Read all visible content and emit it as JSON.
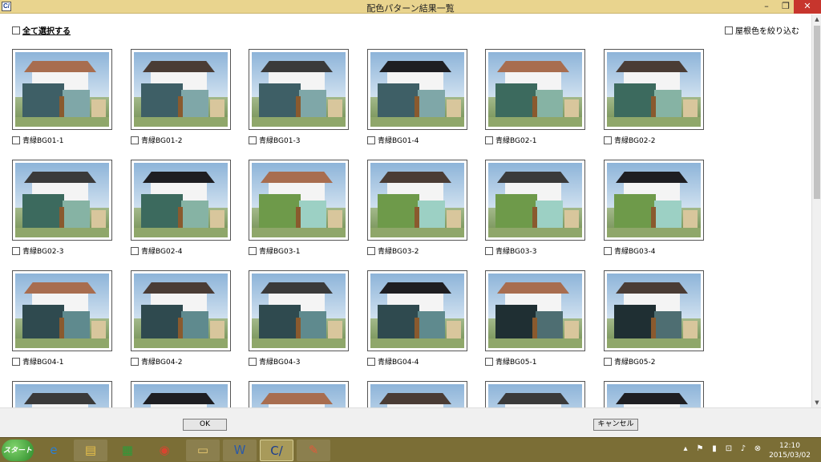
{
  "window": {
    "title": "配色パターン結果一覧",
    "app_icon_text": "C/",
    "min_glyph": "–",
    "max_glyph": "❐",
    "close_glyph": "✕"
  },
  "controls": {
    "select_all_label": "全て選択する",
    "roof_filter_label": "屋根色を絞り込む"
  },
  "items": [
    {
      "label": "青緑BG01-1",
      "roof": "#a86d4f",
      "wall": "#3e5f66",
      "wall2": "#7fa7a8"
    },
    {
      "label": "青緑BG01-2",
      "roof": "#4a3c35",
      "wall": "#3e5f66",
      "wall2": "#7fa7a8"
    },
    {
      "label": "青緑BG01-3",
      "roof": "#3a3a3a",
      "wall": "#3e5f66",
      "wall2": "#7fa7a8"
    },
    {
      "label": "青緑BG01-4",
      "roof": "#1e1e22",
      "wall": "#3e5f66",
      "wall2": "#7fa7a8"
    },
    {
      "label": "青緑BG02-1",
      "roof": "#a86d4f",
      "wall": "#3c6a5e",
      "wall2": "#86b3a4"
    },
    {
      "label": "青緑BG02-2",
      "roof": "#4a3c35",
      "wall": "#3c6a5e",
      "wall2": "#86b3a4"
    },
    {
      "label": "青緑BG02-3",
      "roof": "#3a3a3a",
      "wall": "#3c6a5e",
      "wall2": "#86b3a4"
    },
    {
      "label": "青緑BG02-4",
      "roof": "#1e1e22",
      "wall": "#3c6a5e",
      "wall2": "#86b3a4"
    },
    {
      "label": "青緑BG03-1",
      "roof": "#a86d4f",
      "wall": "#6e9a4a",
      "wall2": "#9cd0c4"
    },
    {
      "label": "青緑BG03-2",
      "roof": "#4a3c35",
      "wall": "#6e9a4a",
      "wall2": "#9cd0c4"
    },
    {
      "label": "青緑BG03-3",
      "roof": "#3a3a3a",
      "wall": "#6e9a4a",
      "wall2": "#9cd0c4"
    },
    {
      "label": "青緑BG03-4",
      "roof": "#1e1e22",
      "wall": "#6e9a4a",
      "wall2": "#9cd0c4"
    },
    {
      "label": "青緑BG04-1",
      "roof": "#a86d4f",
      "wall": "#2f4a4f",
      "wall2": "#5f8a8e"
    },
    {
      "label": "青緑BG04-2",
      "roof": "#4a3c35",
      "wall": "#2f4a4f",
      "wall2": "#5f8a8e"
    },
    {
      "label": "青緑BG04-3",
      "roof": "#3a3a3a",
      "wall": "#2f4a4f",
      "wall2": "#5f8a8e"
    },
    {
      "label": "青緑BG04-4",
      "roof": "#1e1e22",
      "wall": "#2f4a4f",
      "wall2": "#5f8a8e"
    },
    {
      "label": "青緑BG05-1",
      "roof": "#a86d4f",
      "wall": "#1f2f33",
      "wall2": "#4e6e72"
    },
    {
      "label": "青緑BG05-2",
      "roof": "#4a3c35",
      "wall": "#1f2f33",
      "wall2": "#4e6e72"
    },
    {
      "label": "",
      "roof": "#3a3a3a",
      "wall": "#3e5f66",
      "wall2": "#7fa7a8"
    },
    {
      "label": "",
      "roof": "#1e1e22",
      "wall": "#3e5f66",
      "wall2": "#7fa7a8"
    },
    {
      "label": "",
      "roof": "#a86d4f",
      "wall": "#3e5f66",
      "wall2": "#7fa7a8"
    },
    {
      "label": "",
      "roof": "#4a3c35",
      "wall": "#3e5f66",
      "wall2": "#7fa7a8"
    },
    {
      "label": "",
      "roof": "#3a3a3a",
      "wall": "#3e5f66",
      "wall2": "#7fa7a8"
    },
    {
      "label": "",
      "roof": "#1e1e22",
      "wall": "#3e5f66",
      "wall2": "#7fa7a8"
    }
  ],
  "buttons": {
    "ok_label": "OK",
    "cancel_label": "キャンセル"
  },
  "scrollbar": {
    "up_glyph": "▲",
    "down_glyph": "▼"
  },
  "taskbar": {
    "start_label": "スタート",
    "apps": [
      {
        "icon": "ie-icon",
        "glyph": "e"
      },
      {
        "icon": "file-explorer-icon",
        "glyph": "▤"
      },
      {
        "icon": "store-icon",
        "glyph": "▦"
      },
      {
        "icon": "chrome-icon",
        "glyph": "◉"
      },
      {
        "icon": "folder-icon",
        "glyph": "▭"
      },
      {
        "icon": "word-icon",
        "glyph": "W"
      },
      {
        "icon": "color-app-icon",
        "glyph": "C/"
      },
      {
        "icon": "paint-icon",
        "glyph": "✎"
      }
    ],
    "tray_glyphs": [
      "▴",
      "⚑",
      "▮",
      "⊡",
      "♪",
      "⊗"
    ],
    "time": "12:10",
    "date": "2015/03/02"
  }
}
